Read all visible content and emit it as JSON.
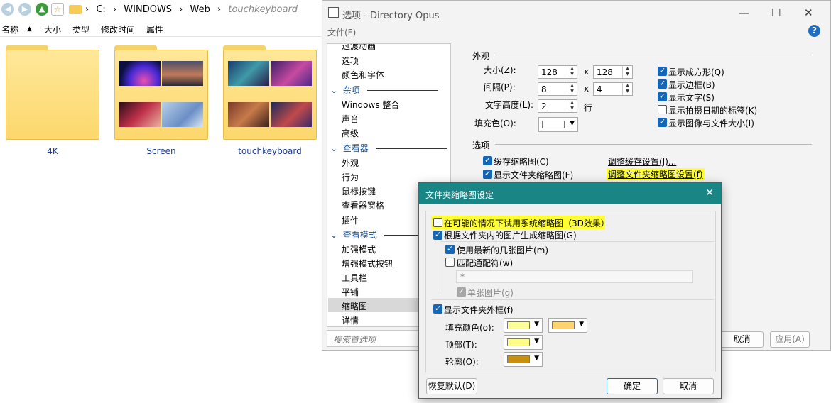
{
  "explorer": {
    "path": [
      "C:",
      "WINDOWS",
      "Web",
      "touchkeyboard"
    ],
    "path_sep": "›",
    "columns": [
      "名称",
      "大小",
      "类型",
      "修改时间",
      "属性"
    ],
    "folders": [
      {
        "name": "4K",
        "has_thumbs": false
      },
      {
        "name": "Screen",
        "has_thumbs": true
      },
      {
        "name": "touchkeyboard",
        "has_thumbs": true
      }
    ]
  },
  "options": {
    "title": "选项 - Directory Opus",
    "menu_file": "文件(F)",
    "tree": {
      "items": [
        {
          "type": "item",
          "label": "过渡动画"
        },
        {
          "type": "item",
          "label": "选项"
        },
        {
          "type": "item",
          "label": "颜色和字体"
        },
        {
          "type": "group",
          "label": "杂项"
        },
        {
          "type": "item",
          "label": "Windows 整合"
        },
        {
          "type": "item",
          "label": "声音"
        },
        {
          "type": "item",
          "label": "高级"
        },
        {
          "type": "group",
          "label": "查看器"
        },
        {
          "type": "item",
          "label": "外观"
        },
        {
          "type": "item",
          "label": "行为"
        },
        {
          "type": "item",
          "label": "鼠标按键"
        },
        {
          "type": "item",
          "label": "查看器窗格"
        },
        {
          "type": "item",
          "label": "插件"
        },
        {
          "type": "group",
          "label": "查看模式"
        },
        {
          "type": "item",
          "label": "加强模式"
        },
        {
          "type": "item",
          "label": "增强模式按钮"
        },
        {
          "type": "item",
          "label": "工具栏"
        },
        {
          "type": "item",
          "label": "平铺"
        },
        {
          "type": "item",
          "label": "缩略图",
          "selected": true
        },
        {
          "type": "item",
          "label": "详情"
        }
      ]
    },
    "search_placeholder": "搜索首选项",
    "appearance": {
      "heading": "外观",
      "size_label": "大小(Z):",
      "size_w": "128",
      "size_h": "128",
      "gap_label": "间隔(P):",
      "gap_w": "8",
      "gap_h": "4",
      "text_height_label": "文字高度(L):",
      "text_height": "2",
      "rows_unit": "行",
      "fill_label": "填充色(O):",
      "times": "x",
      "checks": [
        {
          "label": "显示成方形(Q)",
          "checked": true
        },
        {
          "label": "显示边框(B)",
          "checked": true
        },
        {
          "label": "显示文字(S)",
          "checked": true
        },
        {
          "label": "显示拍摄日期的标签(K)",
          "checked": false
        },
        {
          "label": "显示图像与文件大小(I)",
          "checked": true
        }
      ]
    },
    "opts": {
      "heading": "选项",
      "cache_label": "缓存缩略图(C)",
      "folder_thumbs_label": "显示文件夹缩略图(F)",
      "cache_link": "调整缓存设置(J)...",
      "folder_link": "调整文件夹缩略图设置(f)"
    },
    "cancel": "取消",
    "apply": "应用(A)"
  },
  "dialog": {
    "title": "文件夹缩略图设定",
    "opt_system": "在可能的情况下试用系统缩略图（3D效果）",
    "opt_generate": "根据文件夹内的图片生成缩略图(G)",
    "opt_latest": "使用最新的几张图片(m)",
    "opt_wildcard": "匹配通配符(w)",
    "wildcard_value": "*",
    "opt_single": "单张图片(g)",
    "opt_show_frame": "显示文件夹外框(f)",
    "fill_label": "填充颜色(o):",
    "top_label": "顶部(T):",
    "outline_label": "轮廓(O):",
    "fill_color_1": "#ffff99",
    "fill_color_2": "#ffd36e",
    "top_color": "#ffff88",
    "outline_color": "#c8900e",
    "fill_default": "#ffffff",
    "restore": "恢复默认(D)",
    "ok": "确定",
    "cancel": "取消"
  }
}
